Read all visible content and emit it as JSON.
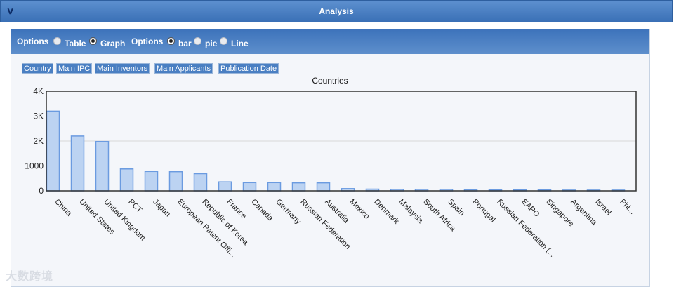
{
  "header": {
    "title": "Analysis",
    "collapse_icon": "double-chevron-down-icon"
  },
  "options": {
    "label1": "Options",
    "view_table": "Table",
    "view_graph": "Graph",
    "view_selected": "Graph",
    "label2": "Options",
    "type_bar": "bar",
    "type_pie": "pie",
    "type_line": "Line",
    "type_selected": "bar"
  },
  "tabs": [
    "Country",
    "Main IPC",
    "Main Inventors",
    "Main Applicants",
    "Publication Date"
  ],
  "watermark": "大数跨境",
  "colors": {
    "bar_fill": "#bcd3f2",
    "bar_stroke": "#6b9be0",
    "header": "#4a7fc2"
  },
  "chart_data": {
    "type": "bar",
    "title": "Countries",
    "categories": [
      "China",
      "United States",
      "United Kingdom",
      "PCT",
      "Japan",
      "European Patent Offi...",
      "Republic of Korea",
      "France",
      "Canada",
      "Germany",
      "Russian Federation",
      "Australia",
      "Mexico",
      "Denmark",
      "Malaysia",
      "South Africa",
      "Spain",
      "Portugal",
      "Russian Federation (...",
      "EAPO",
      "Singapore",
      "Argentina",
      "Israel",
      "Phi..."
    ],
    "values": [
      3200,
      2200,
      1980,
      880,
      780,
      770,
      690,
      360,
      330,
      330,
      320,
      320,
      90,
      70,
      60,
      60,
      60,
      50,
      40,
      40,
      40,
      30,
      30,
      30
    ],
    "ylim": [
      0,
      4000
    ],
    "yticks": [
      {
        "value": 0,
        "label": "0"
      },
      {
        "value": 1000,
        "label": "1000"
      },
      {
        "value": 2000,
        "label": "2K"
      },
      {
        "value": 3000,
        "label": "3K"
      },
      {
        "value": 4000,
        "label": "4K"
      }
    ],
    "grid": true,
    "legend": "none"
  }
}
